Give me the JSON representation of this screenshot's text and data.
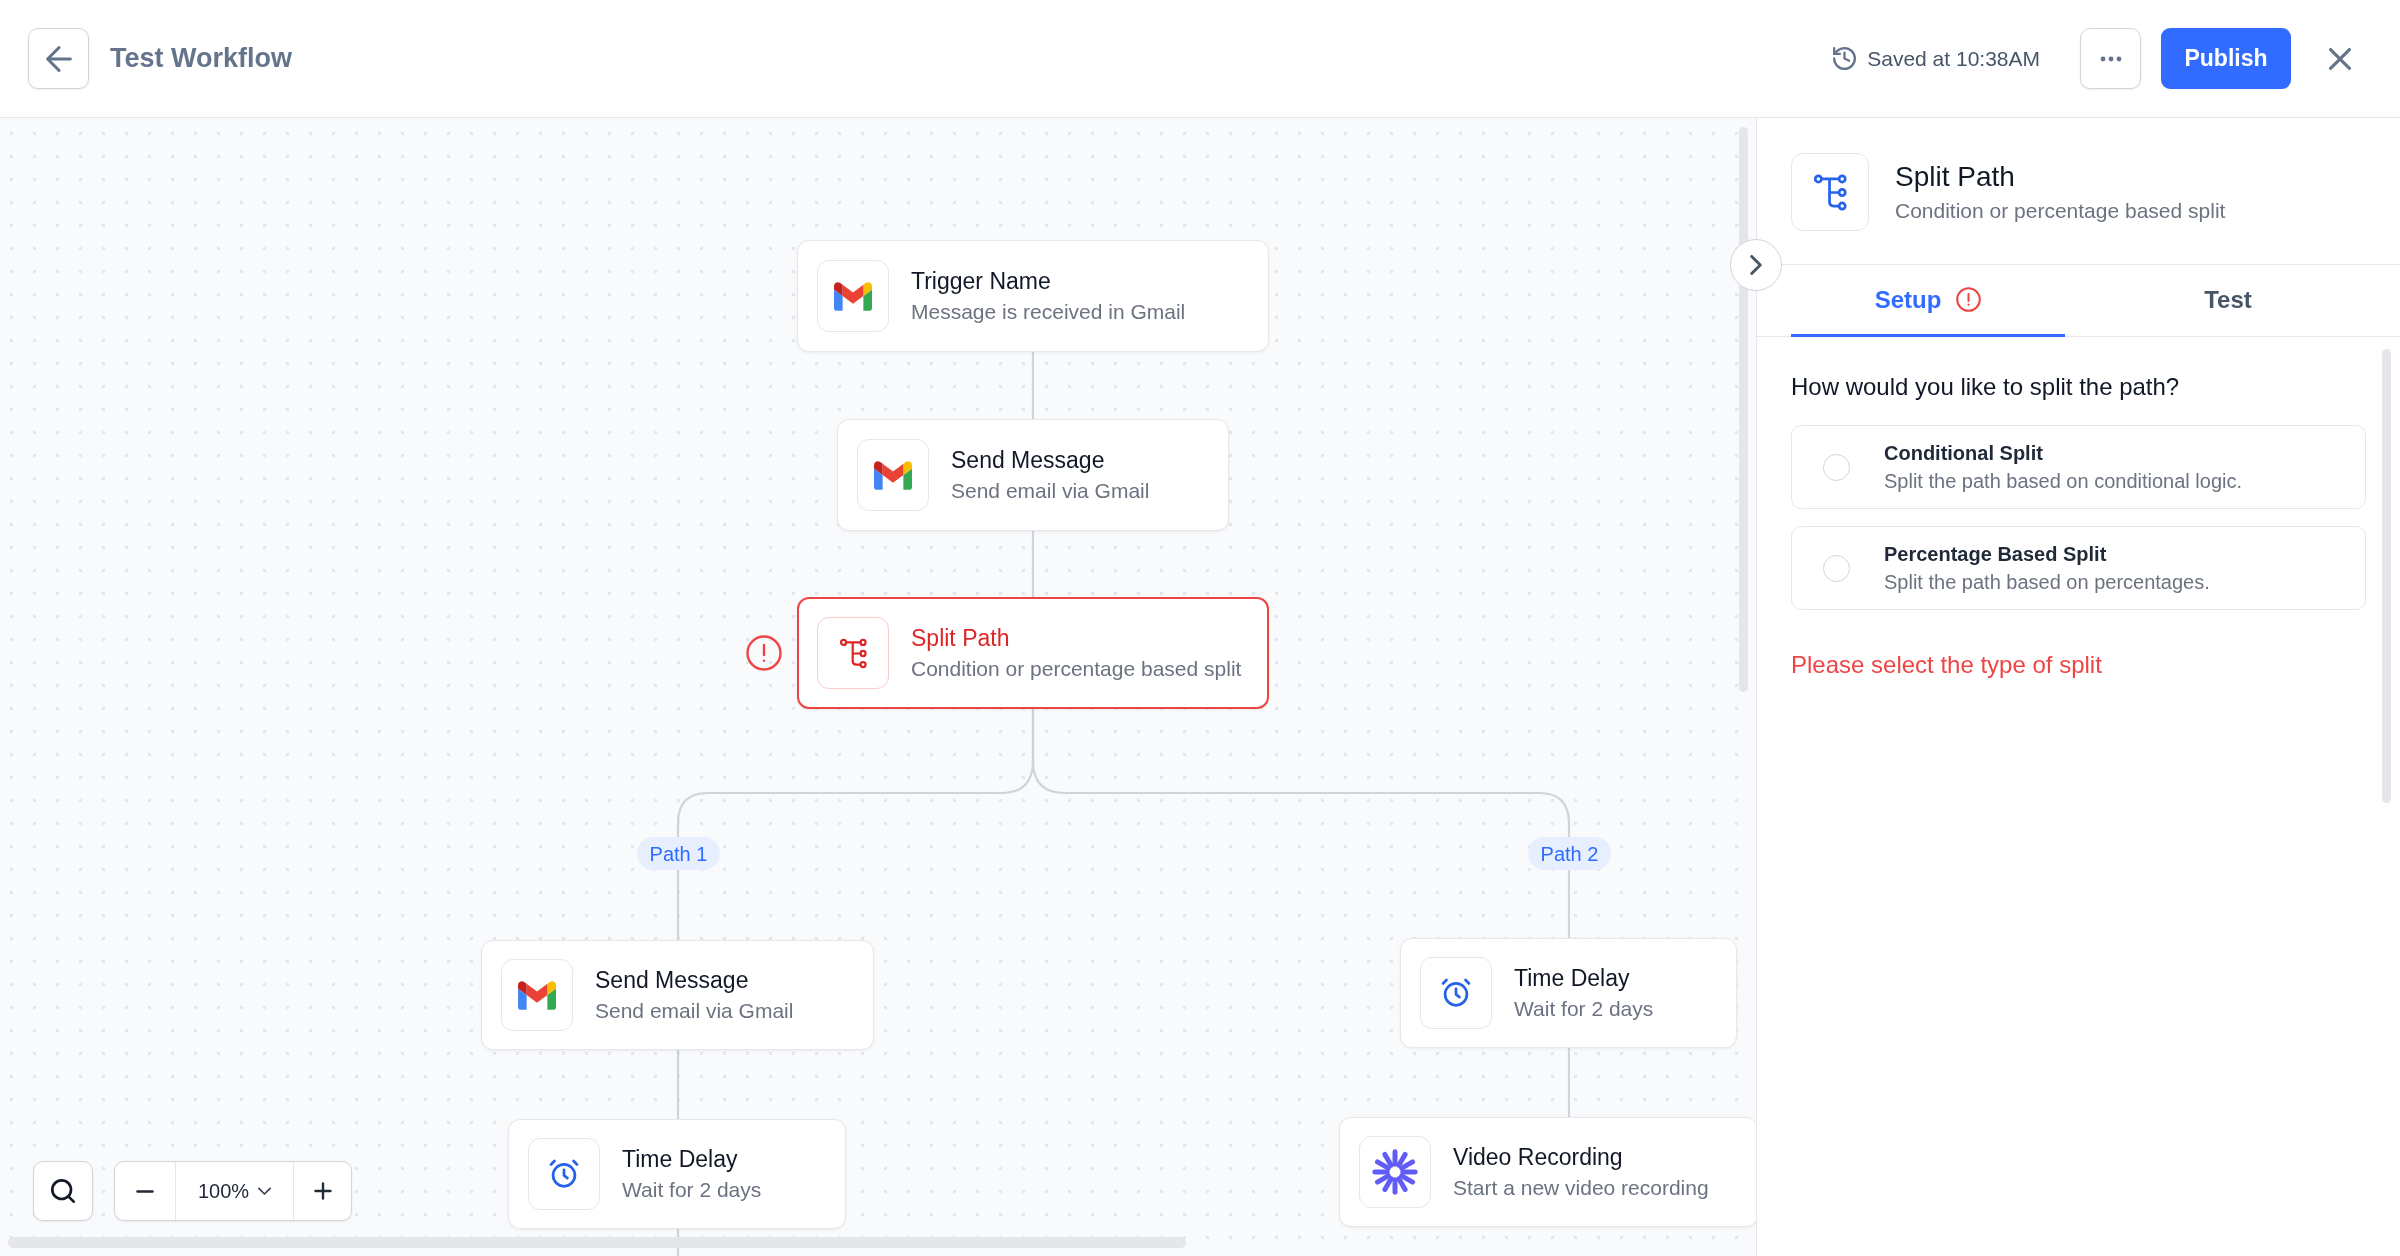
{
  "header": {
    "title": "Test Workflow",
    "saved_status": "Saved at 10:38AM",
    "publish_label": "Publish"
  },
  "canvas": {
    "nodes": [
      {
        "kind": "gmail",
        "title": "Trigger Name",
        "subtitle": "Message is received in Gmail",
        "error": false
      },
      {
        "kind": "gmail",
        "title": "Send Message",
        "subtitle": "Send email via Gmail",
        "error": false
      },
      {
        "kind": "split",
        "title": "Split Path",
        "subtitle": "Condition or percentage based split",
        "error": true
      }
    ],
    "branches": [
      {
        "label": "Path 1",
        "nodes": [
          {
            "kind": "gmail",
            "title": "Send Message",
            "subtitle": "Send email via Gmail",
            "error": false
          },
          {
            "kind": "delay",
            "title": "Time Delay",
            "subtitle": "Wait for 2 days",
            "error": false
          }
        ]
      },
      {
        "label": "Path 2",
        "nodes": [
          {
            "kind": "delay",
            "title": "Time Delay",
            "subtitle": "Wait for 2 days",
            "error": false
          },
          {
            "kind": "recording",
            "title": "Video Recording",
            "subtitle": "Start a new video recording",
            "error": false
          }
        ]
      }
    ],
    "zoom_level": "100%"
  },
  "panel": {
    "kind": "split",
    "title": "Split Path",
    "subtitle": "Condition or percentage based split",
    "tabs": [
      {
        "label": "Setup",
        "selected": true,
        "error": true
      },
      {
        "label": "Test",
        "selected": false,
        "error": false
      }
    ],
    "question": "How would you like to split the path?",
    "options": [
      {
        "title": "Conditional Split",
        "description": "Split the path based on conditional logic.",
        "selected": false
      },
      {
        "title": "Percentage Based Split",
        "description": "Split the path based on percentages.",
        "selected": false
      }
    ],
    "error_message": "Please select the type of split"
  }
}
